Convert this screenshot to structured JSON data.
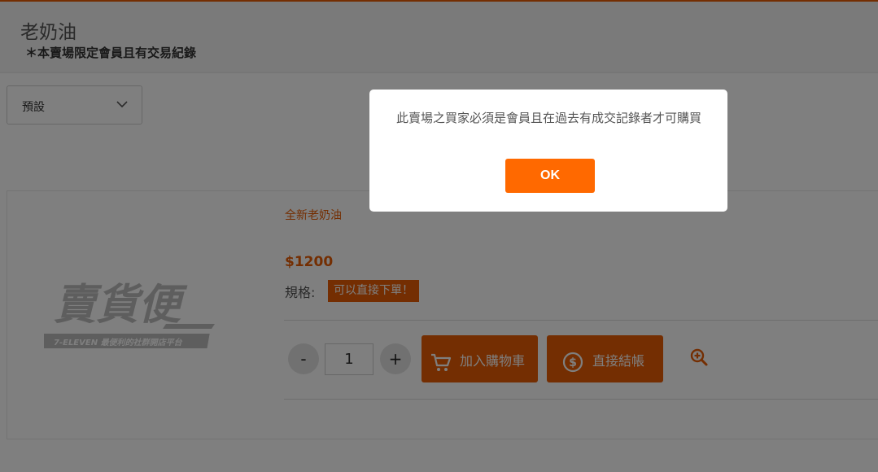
{
  "store": {
    "title": "老奶油",
    "notice": "＊本賣場限定會員且有交易紀錄"
  },
  "sort": {
    "selected": "預設",
    "icon": "chevron-down-icon"
  },
  "product": {
    "logo_text": "賣貨便",
    "logo_subtext": "7-ELEVEN 最便利的社群開店平台",
    "name": "全新老奶油",
    "price": "$1200",
    "spec_label": "規格:",
    "spec_value": "可以直接下單！",
    "quantity": "1",
    "minus_label": "-",
    "plus_label": "+",
    "add_to_cart_label": "加入購物車",
    "checkout_label": "直接結帳"
  },
  "modal": {
    "message": "此賣場之買家必須是會員且在過去有成交記錄者才可購買",
    "ok_label": "OK"
  },
  "colors": {
    "accent": "#e85d04",
    "ok_button": "#ff6900"
  }
}
